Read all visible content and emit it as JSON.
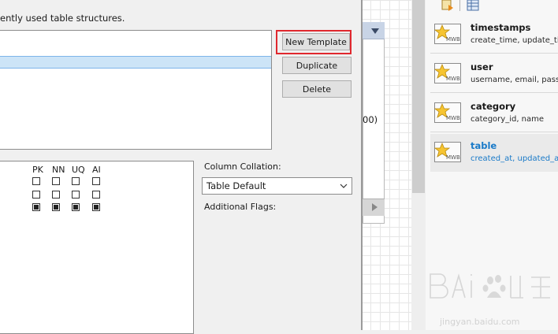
{
  "dialog": {
    "description": "ently used table structures.",
    "buttons": {
      "new_template": "New Template",
      "duplicate": "Duplicate",
      "delete": "Delete"
    },
    "flag_headers": [
      "PK",
      "NN",
      "UQ",
      "AI"
    ],
    "flag_rows": [
      [
        false,
        false,
        false,
        false
      ],
      [
        false,
        false,
        false,
        false
      ],
      [
        true,
        true,
        true,
        true
      ]
    ],
    "column_collation_label": "Column Collation:",
    "column_collation_value": "Table Default",
    "additional_flags_label": "Additional Flags:"
  },
  "side_panel": {
    "fragment": "00)"
  },
  "templates": [
    {
      "name": "timestamps",
      "columns": "create_time, update_tim",
      "badge": "MWB",
      "selected": false
    },
    {
      "name": "user",
      "columns": "username, email, passw",
      "badge": "MWB",
      "selected": false
    },
    {
      "name": "category",
      "columns": "category_id, name",
      "badge": "MWB",
      "selected": false
    },
    {
      "name": "table",
      "columns": "created_at, updated_at",
      "badge": "MWB",
      "selected": true
    }
  ],
  "watermark": {
    "brand": "Baidu",
    "cn": "经验",
    "url": "jingyan.baidu.com"
  },
  "colors": {
    "highlight": "#e0282e",
    "selection": "#cce4f7",
    "link_blue": "#1a7ac8"
  }
}
